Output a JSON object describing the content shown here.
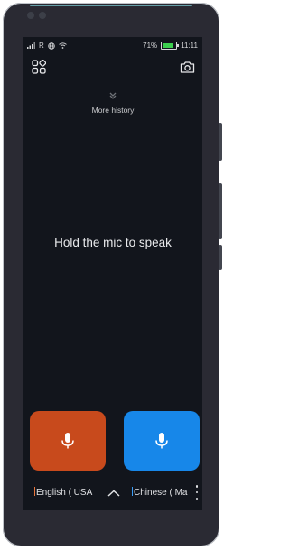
{
  "status_bar": {
    "signal": "▐R",
    "battery_percent": "71%",
    "battery_level": 0.71,
    "time": "11:11",
    "icons": [
      "signal-icon",
      "globe-icon",
      "wifi-icon",
      "battery-icon"
    ]
  },
  "toolbar": {
    "left_icon": "grid-apps-icon",
    "right_icon": "camera-icon"
  },
  "history": {
    "label": "More history"
  },
  "main": {
    "hint": "Hold the mic to speak"
  },
  "mics": {
    "left_color": "#c84a1c",
    "right_color": "#1787e9",
    "icon": "microphone-icon"
  },
  "languages": {
    "left": "English ( USA",
    "right": "Chinese ( Ma"
  }
}
